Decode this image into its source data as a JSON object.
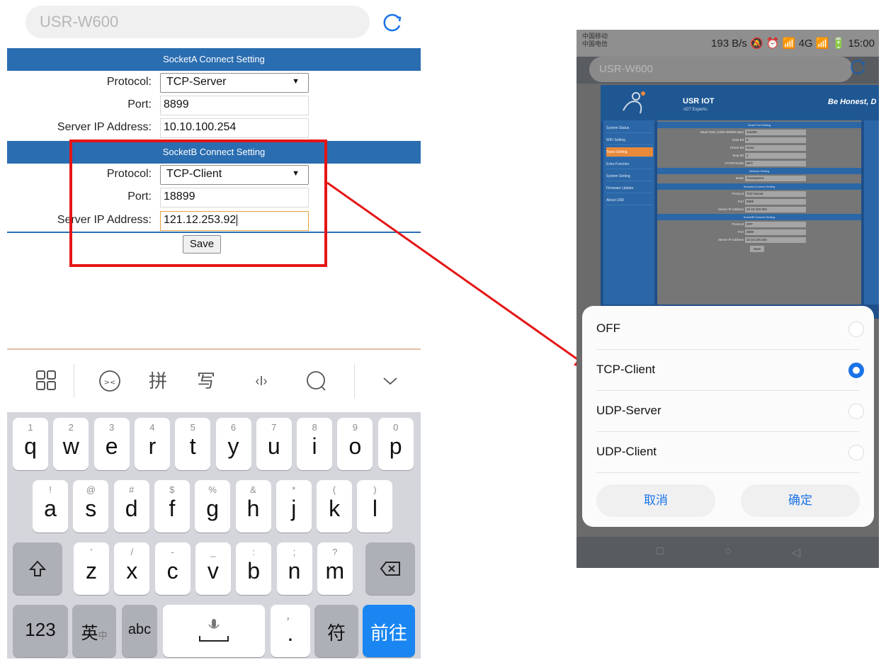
{
  "left": {
    "url": "USR-W600",
    "socketA": {
      "header": "SocketA Connect Setting",
      "protocol_label": "Protocol:",
      "protocol_value": "TCP-Server",
      "port_label": "Port:",
      "port_value": "8899",
      "ip_label": "Server IP Address:",
      "ip_value": "10.10.100.254"
    },
    "socketB": {
      "header": "SocketB Connect Setting",
      "protocol_label": "Protocol:",
      "protocol_value": "TCP-Client",
      "port_label": "Port:",
      "port_value": "18899",
      "ip_label": "Server IP Address:",
      "ip_value": "121.12.253.92"
    },
    "save_label": "Save",
    "toolbar": {
      "pinyin": "拼",
      "handwrite": "写",
      "cursor": "‹I›"
    },
    "keyboard": {
      "row1": [
        {
          "sub": "1",
          "key": "q"
        },
        {
          "sub": "2",
          "key": "w"
        },
        {
          "sub": "3",
          "key": "e"
        },
        {
          "sub": "4",
          "key": "r"
        },
        {
          "sub": "5",
          "key": "t"
        },
        {
          "sub": "6",
          "key": "y"
        },
        {
          "sub": "7",
          "key": "u"
        },
        {
          "sub": "8",
          "key": "i"
        },
        {
          "sub": "9",
          "key": "o"
        },
        {
          "sub": "0",
          "key": "p"
        }
      ],
      "row2": [
        {
          "sub": "!",
          "key": "a"
        },
        {
          "sub": "@",
          "key": "s"
        },
        {
          "sub": "#",
          "key": "d"
        },
        {
          "sub": "$",
          "key": "f"
        },
        {
          "sub": "%",
          "key": "g"
        },
        {
          "sub": "&",
          "key": "h"
        },
        {
          "sub": "*",
          "key": "j"
        },
        {
          "sub": "(",
          "key": "k"
        },
        {
          "sub": ")",
          "key": "l"
        }
      ],
      "row3": [
        {
          "sub": "'",
          "key": "z"
        },
        {
          "sub": "/",
          "key": "x"
        },
        {
          "sub": "-",
          "key": "c"
        },
        {
          "sub": "_",
          "key": "v"
        },
        {
          "sub": ":",
          "key": "b"
        },
        {
          "sub": ";",
          "key": "n"
        },
        {
          "sub": "?",
          "key": "m"
        }
      ],
      "num_key": "123",
      "lang_key": "英",
      "lang_sub": "中",
      "abc_key": "abc",
      "comma_key": "，",
      "period_key": ".",
      "symbol_key": "符",
      "go_key": "前往"
    }
  },
  "right": {
    "status_carrier_1": "中国移动",
    "status_carrier_2": "中国电信",
    "status_right": "193 B/s 🔕 ⏰ 📶 4G 📶 🔋 15:00",
    "url": "USR-W600",
    "site": {
      "title": "USR IOT",
      "subtitle": "-IOT Experts-",
      "slogan": "Be Honest, D",
      "nav": [
        "System Status",
        "WiFi Setting",
        "Trans Setting",
        "Extra Function",
        "System Setting",
        "Firmware Update",
        "About USR"
      ],
      "serial_header": "Serial Port Setting",
      "serial_rows": [
        {
          "label": "Baud Rate (1200-460800 Bps)",
          "value": "115200"
        },
        {
          "label": "Data Bit",
          "value": "8"
        },
        {
          "label": "Check Bit",
          "value": "None"
        },
        {
          "label": "Stop Bit",
          "value": "1"
        },
        {
          "label": "CTSRTS/485",
          "value": "NFC"
        }
      ],
      "network_header": "Network Setting",
      "mode_label": "Mode",
      "mode_value": "Transparent",
      "sa_header": "SocketA Connect Setting",
      "sa_rows": [
        {
          "label": "Protocol",
          "value": "TCP-Server"
        },
        {
          "label": "Port",
          "value": "8899"
        },
        {
          "label": "Server IP Address",
          "value": "10.10.100.254"
        }
      ],
      "sb_header": "SocketB Connect Setting",
      "sb_rows": [
        {
          "label": "Protocol",
          "value": "OFF"
        },
        {
          "label": "Port",
          "value": "8899"
        },
        {
          "label": "Server IP Address",
          "value": "10.10.100.254"
        }
      ],
      "save": "Save"
    },
    "dialog": {
      "options": [
        "OFF",
        "TCP-Client",
        "UDP-Server",
        "UDP-Client"
      ],
      "selected": "TCP-Client",
      "cancel": "取消",
      "confirm": "确定"
    }
  },
  "colors": {
    "header_blue": "#2a6db1",
    "highlight_red": "#e51515",
    "radio_blue": "#1a73e8",
    "go_key_blue": "#1a86f1"
  }
}
